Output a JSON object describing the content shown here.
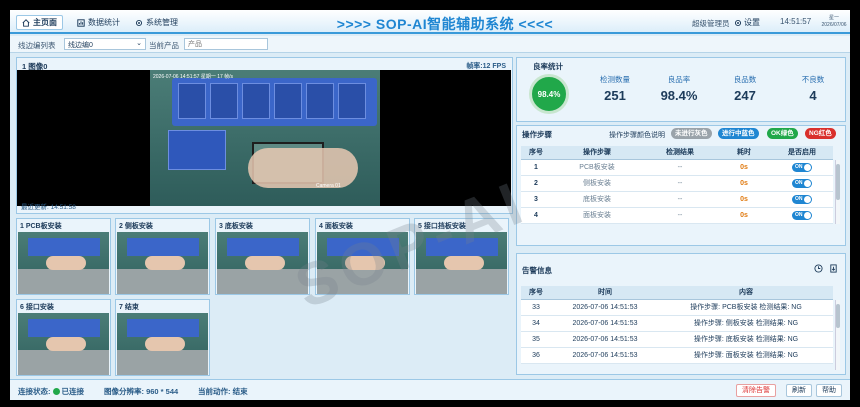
{
  "nav": {
    "tabs": [
      {
        "label": "主页面",
        "icon": "home-icon"
      },
      {
        "label": "数据统计",
        "icon": "chart-icon"
      },
      {
        "label": "系统管理",
        "icon": "gear-icon"
      }
    ],
    "title": ">>>> SOP-AI智能辅助系统 <<<<",
    "user": "超级管理员",
    "settings_label": "设置",
    "clock": "14:51:57",
    "date_line1": "星一",
    "date_line2": "2026/07/06"
  },
  "filter": {
    "line_label": "线边编列表",
    "line_value": "线边编0",
    "product_label": "当前产品",
    "product_placeholder": "产品"
  },
  "video": {
    "title": "1 图像0",
    "fps": "帧率:12 FPS",
    "overlay_time": "2026-07-06 14:51:57 星期一 17 帧/s",
    "camera_label": "Camera 01",
    "updated": "最近更新: 14:51:58"
  },
  "thumbnails": [
    {
      "title": "1 PCB板安装"
    },
    {
      "title": "2 侧板安装"
    },
    {
      "title": "3 底板安装"
    },
    {
      "title": "4 面板安装"
    },
    {
      "title": "5 接口挡板安装"
    },
    {
      "title": "6 接口安装"
    },
    {
      "title": "7 结束"
    }
  ],
  "stats": {
    "title": "良率统计",
    "ring_value": "98.4%",
    "items": [
      {
        "label": "检测数量",
        "value": "251"
      },
      {
        "label": "良品率",
        "value": "98.4%"
      },
      {
        "label": "良品数",
        "value": "247"
      },
      {
        "label": "不良数",
        "value": "4"
      }
    ]
  },
  "steps": {
    "title": "操作步骤",
    "legend_label": "操作步骤颜色说明",
    "legend": [
      {
        "label": "未进行灰色",
        "color": "#9aa3aa"
      },
      {
        "label": "进行中蓝色",
        "color": "#1f86d2"
      },
      {
        "label": "OK绿色",
        "color": "#21a84a"
      },
      {
        "label": "NG红色",
        "color": "#d9302c"
      }
    ],
    "headers": [
      "序号",
      "操作步骤",
      "检测结果",
      "耗时",
      "是否启用"
    ],
    "rows": [
      {
        "no": "1",
        "step": "PCB板安装",
        "result": "--",
        "time": "0s",
        "toggle": "ON"
      },
      {
        "no": "2",
        "step": "侧板安装",
        "result": "--",
        "time": "0s",
        "toggle": "ON"
      },
      {
        "no": "3",
        "step": "底板安装",
        "result": "--",
        "time": "0s",
        "toggle": "ON"
      },
      {
        "no": "4",
        "step": "面板安装",
        "result": "--",
        "time": "0s",
        "toggle": "ON"
      }
    ]
  },
  "alarms": {
    "title": "告警信息",
    "headers": [
      "序号",
      "时间",
      "内容"
    ],
    "rows": [
      {
        "no": "33",
        "time": "2026-07-06 14:51:53",
        "content": "操作步骤: PCB板安装 检测结果: NG"
      },
      {
        "no": "34",
        "time": "2026-07-06 14:51:53",
        "content": "操作步骤: 侧板安装 检测结果: NG"
      },
      {
        "no": "35",
        "time": "2026-07-06 14:51:53",
        "content": "操作步骤: 底板安装 检测结果: NG"
      },
      {
        "no": "36",
        "time": "2026-07-06 14:51:53",
        "content": "操作步骤: 面板安装 检测结果: NG"
      }
    ]
  },
  "status": {
    "conn_label": "连接状态:",
    "conn_value": "已连接",
    "res_label": "图像分辨率: 960 * 544",
    "action_label": "当前动作: 结束",
    "btn_clear": "清除告警",
    "btn_refresh": "刷新",
    "btn_help": "帮助"
  },
  "watermark": "SOP-AI"
}
